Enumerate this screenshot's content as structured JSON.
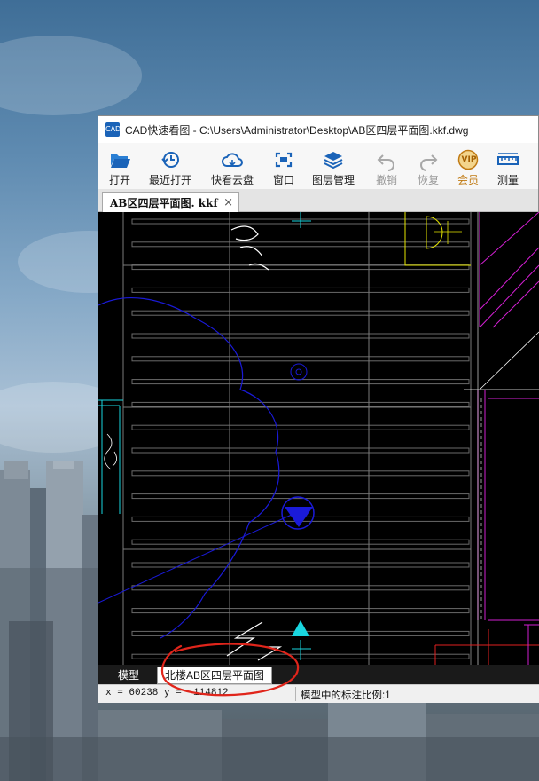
{
  "window": {
    "title": "CAD快速看图 - C:\\Users\\Administrator\\Desktop\\AB区四层平面图.kkf.dwg",
    "app_icon_text": "CAD"
  },
  "toolbar": {
    "items": [
      {
        "label": "打开",
        "icon": "folder-open-icon",
        "enabled": true
      },
      {
        "label": "最近打开",
        "icon": "recent-clock-icon",
        "enabled": true
      },
      {
        "label": "快看云盘",
        "icon": "cloud-icon",
        "enabled": true
      },
      {
        "label": "窗口",
        "icon": "window-zoom-icon",
        "enabled": true
      },
      {
        "label": "图层管理",
        "icon": "layers-icon",
        "enabled": true
      },
      {
        "label": "撤销",
        "icon": "undo-icon",
        "enabled": false
      },
      {
        "label": "恢复",
        "icon": "redo-icon",
        "enabled": false
      },
      {
        "label": "会员",
        "icon": "vip-badge-icon",
        "enabled": true,
        "badge_text": "VIP"
      },
      {
        "label": "测量",
        "icon": "ruler-icon",
        "enabled": true
      }
    ]
  },
  "document_tab": {
    "label": "AB区四层平面图. kkf",
    "close": "×"
  },
  "layout_tabs": {
    "model": "模型",
    "sheet": "北楼AB区四层平面图"
  },
  "status": {
    "coordinates": "x = 60238  y = -114812",
    "scale_text": "模型中的标注比例:1"
  },
  "colors": {
    "canvas_bg": "#000000",
    "accent_blue": "#1a63b8",
    "vip_gold": "#c07a12",
    "annotation_red": "#e0251b",
    "cad_magenta": "#d21fd2",
    "cad_yellow": "#e6e600",
    "cad_blue": "#1a1ad8",
    "cad_cyan": "#19d6e0"
  }
}
